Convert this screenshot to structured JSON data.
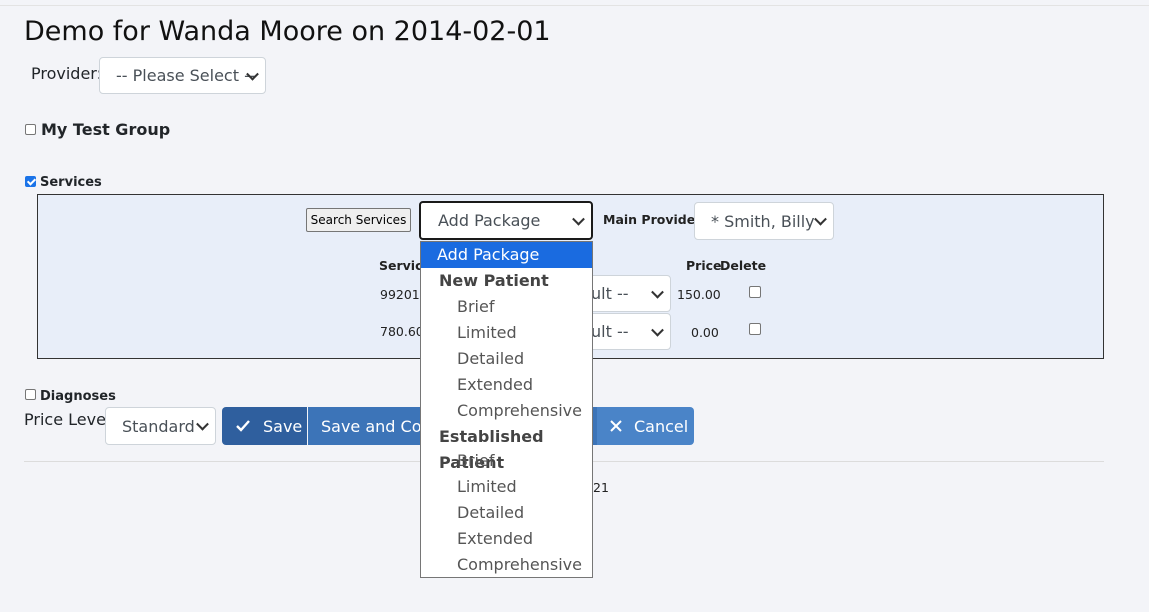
{
  "page_title": "Demo for Wanda Moore on 2014-02-01",
  "provider": {
    "label": "Provider:",
    "value": "-- Please Select --"
  },
  "groups": {
    "my_test_group": "My Test Group",
    "services": "Services",
    "diagnoses": "Diagnoses"
  },
  "services_panel": {
    "search_button": "Search Services",
    "package_select_value": "Add Package",
    "main_provider_label": "Main Provider:",
    "main_provider_value": "* Smith, Billy",
    "columns": {
      "service": "Service",
      "price": "Price",
      "delete": "Delete"
    },
    "rows": [
      {
        "code": "99201",
        "level": "ult --",
        "price": "150.00"
      },
      {
        "code": "780.60",
        "level": "ult --",
        "price": "0.00"
      }
    ]
  },
  "price_level": {
    "label": "Price Level:",
    "value": "Standard"
  },
  "buttons": {
    "save": "Save",
    "save_continue": "Save and Cont",
    "cancel": "Cancel"
  },
  "footer_fragment": "21",
  "package_dropdown": {
    "selected": "Add Package",
    "groups": [
      {
        "label": "New Patient",
        "options": [
          "Brief",
          "Limited",
          "Detailed",
          "Extended",
          "Comprehensive"
        ]
      },
      {
        "label": "Established Patient",
        "options": [
          "Brief",
          "Limited",
          "Detailed",
          "Extended",
          "Comprehensive"
        ]
      }
    ]
  },
  "colors": {
    "primary_button": "#3c74b8",
    "save_button": "#2f5f9e",
    "cancel_button": "#4a84c8",
    "panel_bg": "#e8eef9",
    "dropdown_selected": "#1a6be0"
  }
}
